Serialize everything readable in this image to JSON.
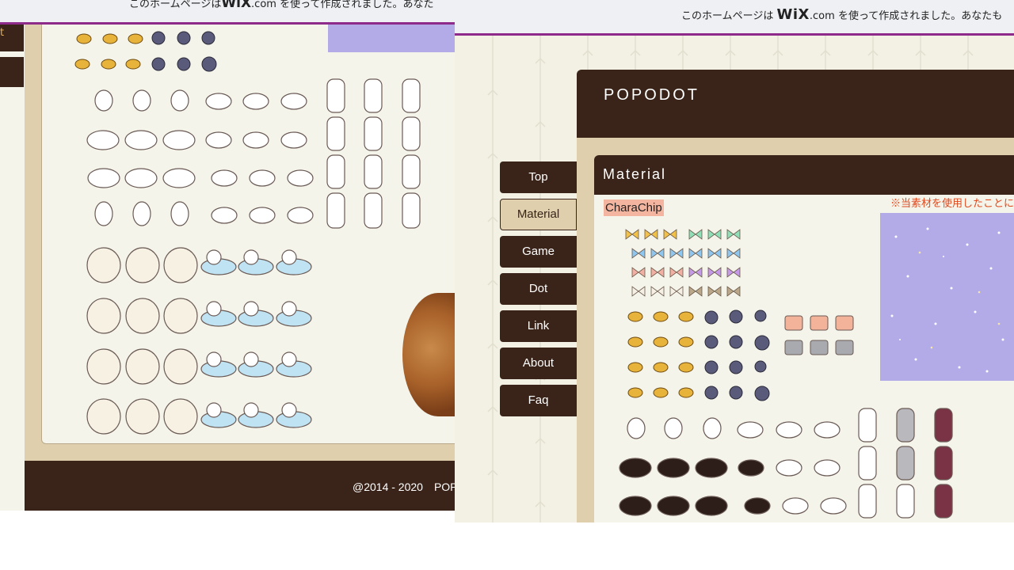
{
  "wix_banner": {
    "prefix": "このホームページは",
    "brand": "WiX",
    "suffix": ".com",
    "rest": "を使って作成されました。あなたも",
    "rest_left": "を使って作成されました。あなた"
  },
  "site_title": "POPODOT",
  "nav": [
    {
      "label": "Top",
      "active": false
    },
    {
      "label": "Material",
      "active": true
    },
    {
      "label": "Game",
      "active": false
    },
    {
      "label": "Dot",
      "active": false
    },
    {
      "label": "Link",
      "active": false
    },
    {
      "label": "About",
      "active": false
    },
    {
      "label": "Faq",
      "active": false
    }
  ],
  "section_title": "Material",
  "subsection_label": "CharaChip",
  "notice": "※当素材を使用したことに",
  "footer_text": "@2014 - 2020　POP",
  "left_edge_char": "t",
  "colors": {
    "dark_brown": "#3a2419",
    "tan": "#dfcfac",
    "cream": "#f5f4ea",
    "wix_line": "#8e2a8a",
    "sky": "#b3abe7",
    "notice_red": "#e04a1f"
  }
}
